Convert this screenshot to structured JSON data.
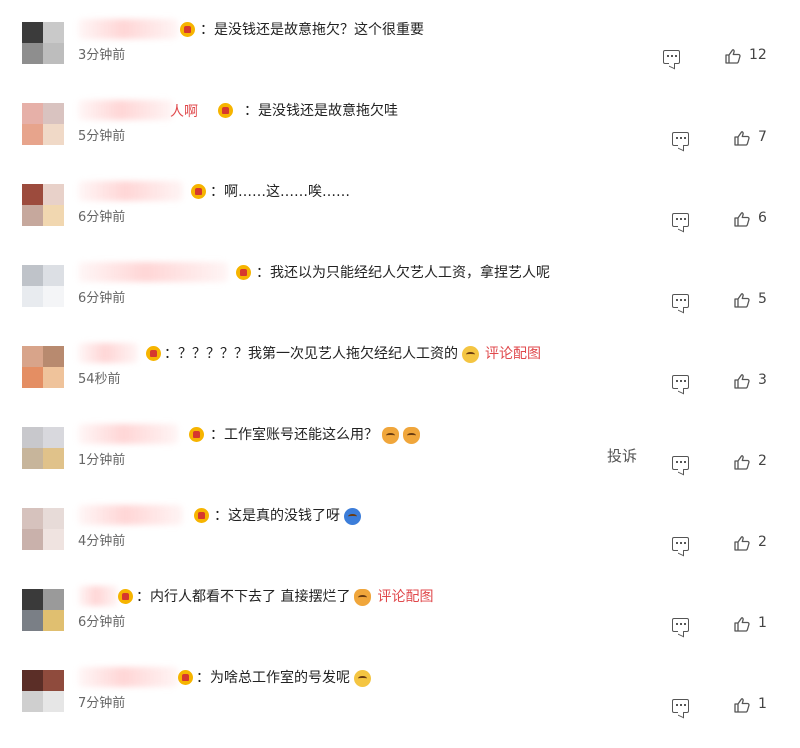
{
  "comments": [
    {
      "name_fragment": "",
      "text": "：是没钱还是故意拖欠？这个很重要",
      "emoji": [],
      "link": "",
      "time": "3分钟前",
      "likes": "12",
      "report": ""
    },
    {
      "name_fragment": "人啊",
      "text": "：是没钱还是故意拖欠哇",
      "emoji": [],
      "link": "",
      "time": "5分钟前",
      "likes": "7",
      "report": ""
    },
    {
      "name_fragment": "",
      "text": "：啊……这……唉……",
      "emoji": [],
      "link": "",
      "time": "6分钟前",
      "likes": "6",
      "report": ""
    },
    {
      "name_fragment": "",
      "text": "：我还以为只能经纪人欠艺人工资，拿捏艺人呢",
      "emoji": [],
      "link": "",
      "time": "6分钟前",
      "likes": "5",
      "report": ""
    },
    {
      "name_fragment": "",
      "text": "：？？？？？我第一次见艺人拖欠经纪人工资的",
      "emoji": [
        "smile"
      ],
      "link": "评论配图",
      "time": "54秒前",
      "likes": "3",
      "report": ""
    },
    {
      "name_fragment": "",
      "text": "：工作室账号还能这么用？",
      "emoji": [
        "cat",
        "cat"
      ],
      "link": "",
      "time": "1分钟前",
      "likes": "2",
      "report": "投诉"
    },
    {
      "name_fragment": "",
      "text": "：这是真的没钱了呀",
      "emoji": [
        "blue"
      ],
      "link": "",
      "time": "4分钟前",
      "likes": "2",
      "report": ""
    },
    {
      "name_fragment": "",
      "text": "：内行人都看不下去了 直接摆烂了",
      "emoji": [
        "cat"
      ],
      "link": "评论配图",
      "time": "6分钟前",
      "likes": "1",
      "report": ""
    },
    {
      "name_fragment": "",
      "text": "：为啥总工作室的号发呢",
      "emoji": [
        "smile"
      ],
      "link": "",
      "time": "7分钟前",
      "likes": "1",
      "report": ""
    }
  ],
  "icons": {
    "reply": "comment-bubble-icon",
    "like": "thumbs-up-icon",
    "badge": "vip-crown-icon"
  },
  "colors": {
    "text": "#222222",
    "time": "#666666",
    "accent": "#e0494c"
  }
}
